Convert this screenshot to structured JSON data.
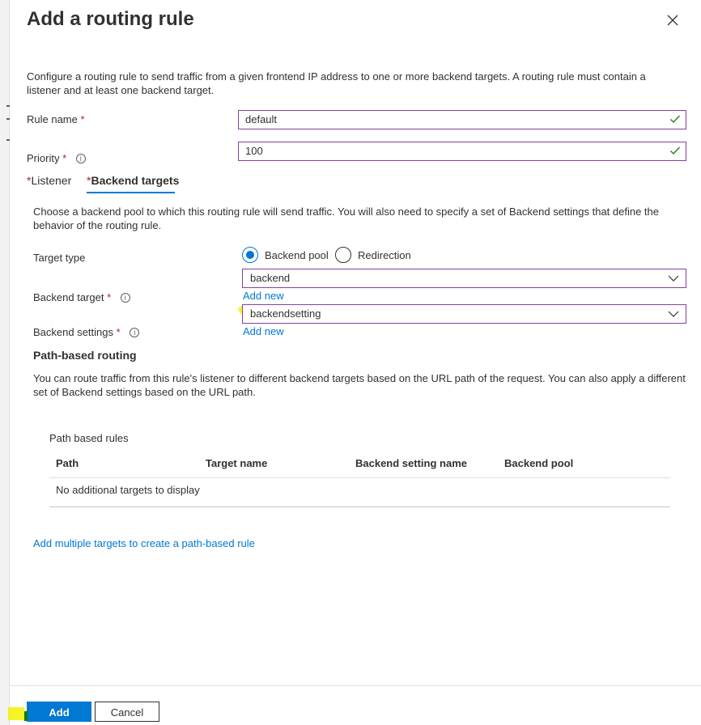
{
  "dialog": {
    "title": "Add a routing rule",
    "description": "Configure a routing rule to send traffic from a given frontend IP address to one or more backend targets. A routing rule must contain a listener and at least one backend target."
  },
  "fields": {
    "rule_name": {
      "label": "Rule name",
      "required_mark": "*",
      "value": "default"
    },
    "priority": {
      "label": "Priority",
      "required_mark": "*",
      "value": "100"
    }
  },
  "tabs": [
    {
      "star": "*",
      "label": "Listener",
      "active": false
    },
    {
      "star": "*",
      "label": "Backend targets",
      "active": true
    }
  ],
  "backend": {
    "description": "Choose a backend pool to which this routing rule will send traffic. You will also need to specify a set of Backend settings that define the behavior of the routing rule.",
    "target_type": {
      "label": "Target type",
      "options": [
        "Backend pool",
        "Redirection"
      ],
      "selected": "Backend pool"
    },
    "backend_target": {
      "label": "Backend target",
      "required_mark": "*",
      "value": "backend",
      "add_new": "Add new"
    },
    "backend_settings": {
      "label": "Backend settings",
      "required_mark": "*",
      "value": "backendsetting",
      "add_new": "Add new"
    }
  },
  "path_routing": {
    "heading": "Path-based routing",
    "description": "You can route traffic from this rule's listener to different backend targets based on the URL path of the request. You can also apply a different set of Backend settings based on the URL path.",
    "table_title": "Path based rules",
    "columns": [
      "Path",
      "Target name",
      "Backend setting name",
      "Backend pool"
    ],
    "empty_text": "No additional targets to display",
    "add_link": "Add multiple targets to create a path-based rule"
  },
  "footer": {
    "add_label": "Add",
    "cancel_label": "Cancel"
  },
  "colors": {
    "accent": "#0078d4",
    "input_border": "#8a3f9e",
    "valid_check": "#107c10",
    "required": "#a4262c",
    "annotation_highlight": "#f3f200"
  },
  "icons": {
    "close": "close-icon",
    "check": "checkmark-icon",
    "info": "info-icon",
    "chevron": "chevron-down-icon"
  }
}
